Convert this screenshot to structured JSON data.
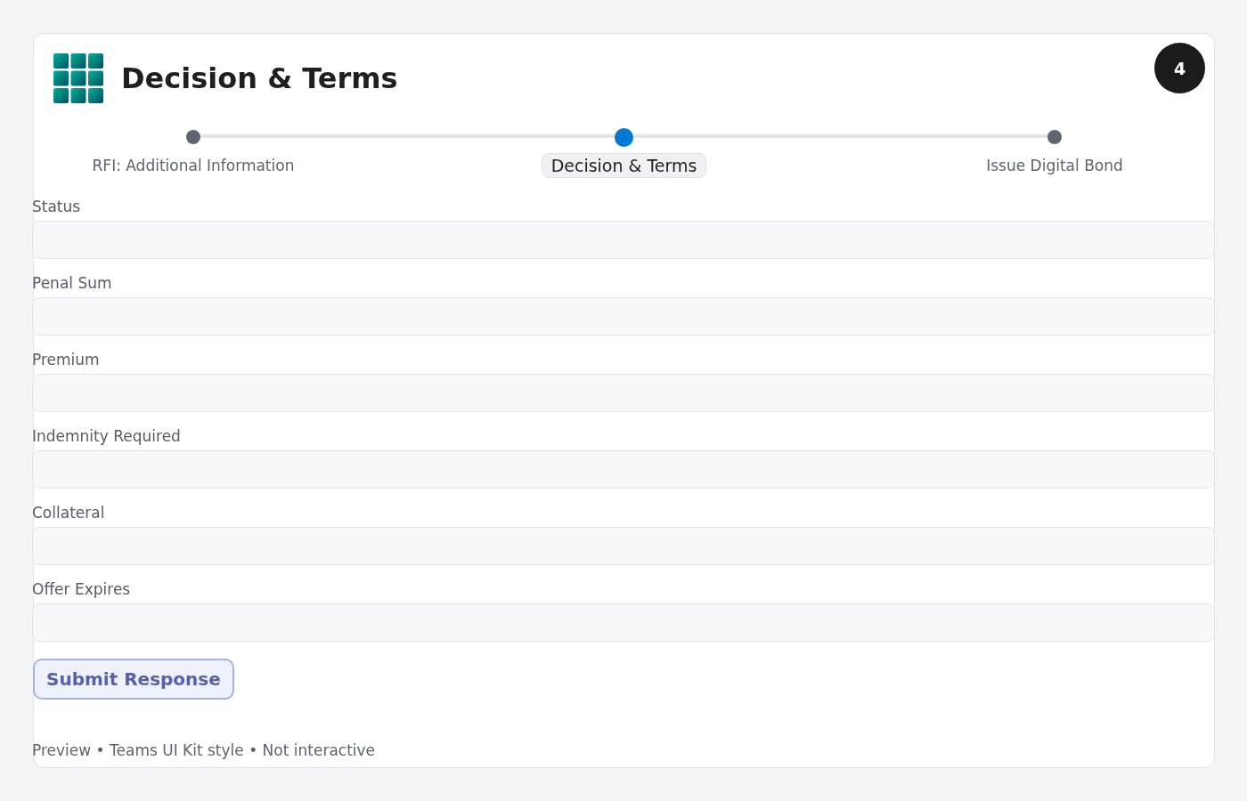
{
  "card": {
    "title": "Decision & Terms",
    "badge": "4"
  },
  "steps": [
    {
      "label": "RFI: Additional Information",
      "selected": false
    },
    {
      "label": "Decision & Terms",
      "selected": true
    },
    {
      "label": "Issue Digital Bond",
      "selected": false
    }
  ],
  "fields": [
    {
      "label": "Status"
    },
    {
      "label": "Penal Sum"
    },
    {
      "label": "Premium"
    },
    {
      "label": "Indemnity Required"
    },
    {
      "label": "Collateral"
    },
    {
      "label": "Offer Expires"
    }
  ],
  "button": "Submit Response",
  "footer": "Preview • Teams UI Kit style • Not interactive"
}
